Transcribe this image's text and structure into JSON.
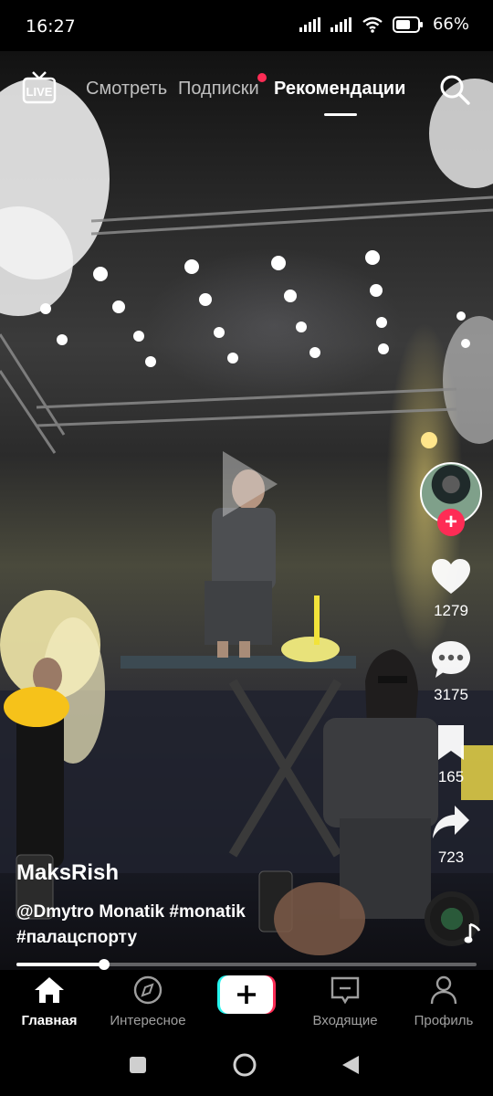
{
  "status_bar": {
    "time": "16:27",
    "battery": "66%"
  },
  "top_nav": {
    "tabs": [
      {
        "label": "Смотреть",
        "active": false
      },
      {
        "label": "Подписки",
        "active": false,
        "has_notification_dot": true
      },
      {
        "label": "Рекомендации",
        "active": true
      }
    ]
  },
  "actions": {
    "likes": "1279",
    "comments": "3175",
    "saves": "165",
    "shares": "723"
  },
  "post": {
    "author": "MaksRish",
    "caption_line1": "@Dmytro Monatik #monatik",
    "caption_line2": "#палацспорту",
    "progress": 0.19
  },
  "bottom_nav": {
    "items": [
      {
        "label": "Главная",
        "icon": "home-icon",
        "active": true
      },
      {
        "label": "Интересное",
        "icon": "compass-icon",
        "active": false
      },
      {
        "label": "Входящие",
        "icon": "inbox-icon",
        "active": false
      },
      {
        "label": "Профиль",
        "icon": "profile-icon",
        "active": false
      }
    ]
  },
  "colors": {
    "accent": "#fe2c55",
    "cyan": "#25f4ee"
  }
}
